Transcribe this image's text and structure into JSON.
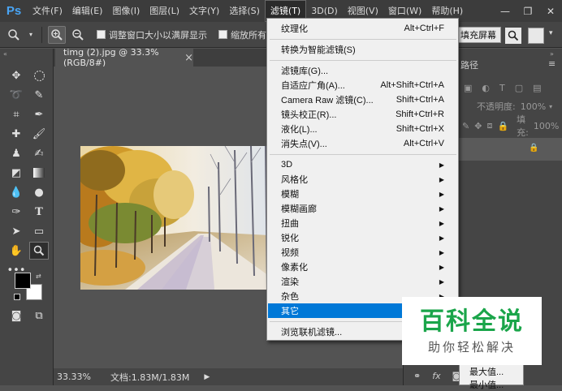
{
  "app": {
    "logo": "Ps"
  },
  "menubar": {
    "items": [
      "文件(F)",
      "编辑(E)",
      "图像(I)",
      "图层(L)",
      "文字(Y)",
      "选择(S)",
      "滤镜(T)",
      "3D(D)",
      "视图(V)",
      "窗口(W)",
      "帮助(H)"
    ],
    "active_index": 6
  },
  "window_controls": {
    "minimize": "—",
    "restore": "❐",
    "close": "✕"
  },
  "options_bar": {
    "resize_windows_label": "调整窗口大小以满屏显示",
    "zoom_all_label": "缩放所有",
    "fill_screen_label": "填充屏幕"
  },
  "document": {
    "tab_title": "timg (2).jpg @ 33.3%(RGB/8#)",
    "tab_close": "×",
    "zoom": "33.33%",
    "doc_info": "文档:1.83M/1.83M"
  },
  "right_panel": {
    "paths_tab": "路径",
    "opacity_label": "不透明度:",
    "opacity_value": "100%",
    "fill_label": "填充:",
    "fill_value": "100%"
  },
  "filter_menu": {
    "last_filter": {
      "label": "纹理化",
      "shortcut": "Alt+Ctrl+F"
    },
    "convert_smart": {
      "label": "转换为智能滤镜(S)"
    },
    "group1": [
      {
        "label": "滤镜库(G)...",
        "shortcut": ""
      },
      {
        "label": "自适应广角(A)...",
        "shortcut": "Alt+Shift+Ctrl+A"
      },
      {
        "label": "Camera Raw 滤镜(C)...",
        "shortcut": "Shift+Ctrl+A"
      },
      {
        "label": "镜头校正(R)...",
        "shortcut": "Shift+Ctrl+R"
      },
      {
        "label": "液化(L)...",
        "shortcut": "Shift+Ctrl+X"
      },
      {
        "label": "消失点(V)...",
        "shortcut": "Alt+Ctrl+V"
      }
    ],
    "submenus": [
      "3D",
      "风格化",
      "模糊",
      "模糊画廊",
      "扭曲",
      "锐化",
      "视频",
      "像素化",
      "渲染",
      "杂色",
      "其它"
    ],
    "highlighted_submenu": "其它",
    "browse_online": {
      "label": "浏览联机滤镜..."
    }
  },
  "submenu_peek": {
    "items": [
      "最大值...",
      "最小值..."
    ]
  },
  "watermark": {
    "title": "百科全说",
    "subtitle": "助你轻松解决"
  },
  "colors": {
    "menu_highlight": "#0078d7",
    "watermark_green": "#1aa54a",
    "ps_blue": "#49a5f5"
  }
}
